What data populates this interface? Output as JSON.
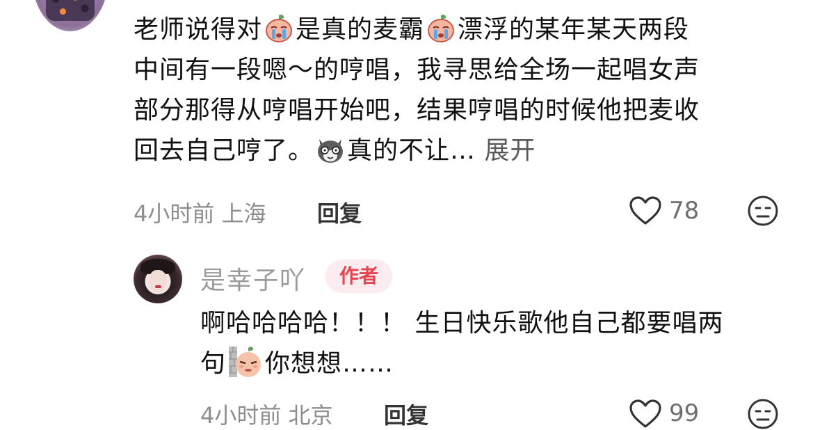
{
  "comment": {
    "text_part1": "老师说得对",
    "text_part2": "是真的麦霸",
    "text_part3": "漂浮的某年某天两段",
    "text_line2": "中间有一段嗯～的哼唱，我寻思给全场一起唱女声",
    "text_line3": "部分那得从哼唱开始吧，结果哼唱的时候他把麦收",
    "text_line4": "回去自己哼了。",
    "text_line4_after": "真的不让…",
    "expand_label": "展开",
    "time": "4小时前",
    "location": "上海",
    "reply_label": "回复",
    "like_count": "78",
    "emoji_names": [
      "crying-peach-emoji",
      "crying-peach-emoji",
      "gray-cat-emoji"
    ]
  },
  "reply": {
    "author": "是幸子吖",
    "author_badge": "作者",
    "text_line1": "啊哈哈哈哈！！！ 生日快乐歌他自己都要唱两",
    "text_line2_before": "句",
    "text_line2_after": "你想想……",
    "time": "4小时前",
    "location": "北京",
    "reply_label": "回复",
    "like_count": "99",
    "emoji_names": [
      "peeking-peach-emoji"
    ]
  },
  "colors": {
    "text": "#111111",
    "meta": "#8d8d8d",
    "author_badge_bg": "#fcebef",
    "author_badge_text": "#e8434e"
  }
}
